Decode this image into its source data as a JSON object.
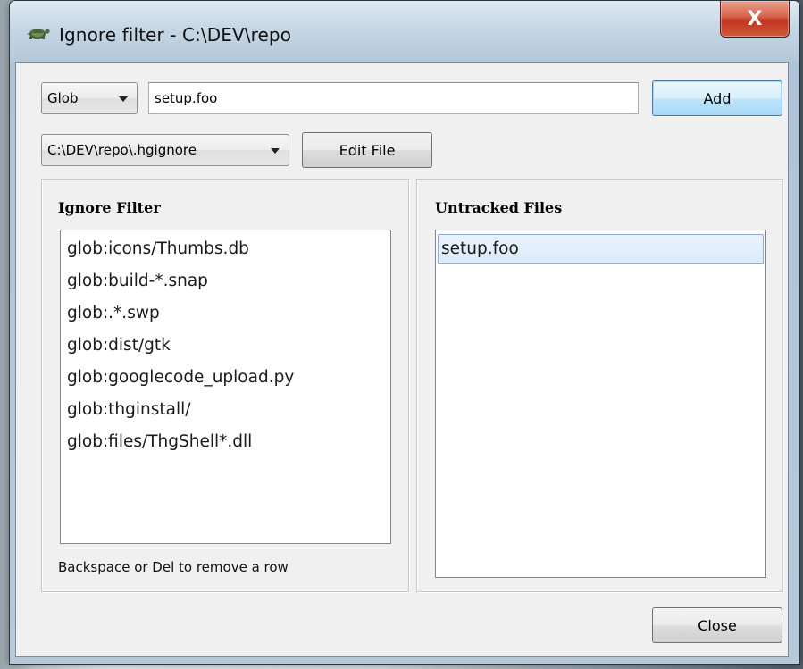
{
  "window": {
    "title": "Ignore filter - C:\\DEV\\repo",
    "close_glyph": "X"
  },
  "toolbar": {
    "pattern_type_selected": "Glob",
    "pattern_value": "setup.foo",
    "add_label": "Add",
    "ignore_file_selected": "C:\\DEV\\repo\\.hgignore",
    "edit_file_label": "Edit File"
  },
  "ignore_panel": {
    "title": "Ignore Filter",
    "items": [
      "glob:icons/Thumbs.db",
      "glob:build-*.snap",
      "glob:.*.swp",
      "glob:dist/gtk",
      "glob:googlecode_upload.py",
      "glob:thginstall/",
      "glob:files/ThgShell*.dll"
    ],
    "hint": "Backspace or Del to remove a row"
  },
  "untracked_panel": {
    "title": "Untracked Files",
    "items": [
      "setup.foo"
    ]
  },
  "footer": {
    "close_label": "Close"
  },
  "colors": {
    "selection_fill": "#dbeaf9",
    "selection_border": "#84acdd",
    "close_red": "#c0351e"
  },
  "icons": {
    "app": "tortoise-icon",
    "close": "close-icon",
    "dropdown": "chevron-down-icon"
  }
}
